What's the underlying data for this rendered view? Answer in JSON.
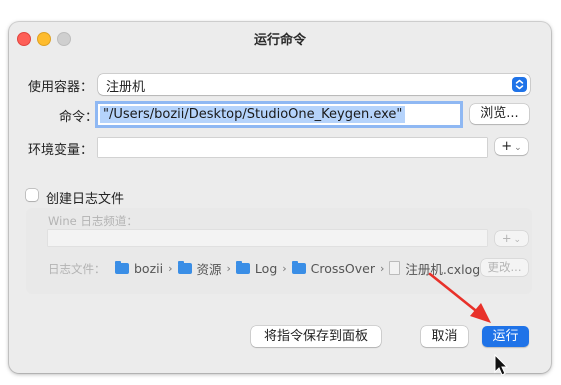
{
  "window": {
    "title": "运行命令"
  },
  "form": {
    "container_label": "使用容器：",
    "container_value": "注册机",
    "command_label": "命令：",
    "command_value": "\"/Users/bozii/Desktop/StudioOne_Keygen.exe\"",
    "browse_label": "浏览...",
    "env_label": "环境变量：",
    "env_value": "",
    "env_add_label": "+"
  },
  "log": {
    "checkbox_label": "创建日志文件",
    "channels_label": "Wine 日志频道：",
    "channels_value": "",
    "channels_add_label": "+",
    "file_label": "日志文件：",
    "path": [
      "bozii",
      "资源",
      "Log",
      "CrossOver",
      "注册机.cxlog"
    ],
    "change_label": "更改..."
  },
  "buttons": {
    "save_command": "将指令保存到面板",
    "cancel": "取消",
    "run": "运行"
  },
  "colors": {
    "accent": "#1f73e8",
    "annotation_arrow": "#e8312a"
  }
}
